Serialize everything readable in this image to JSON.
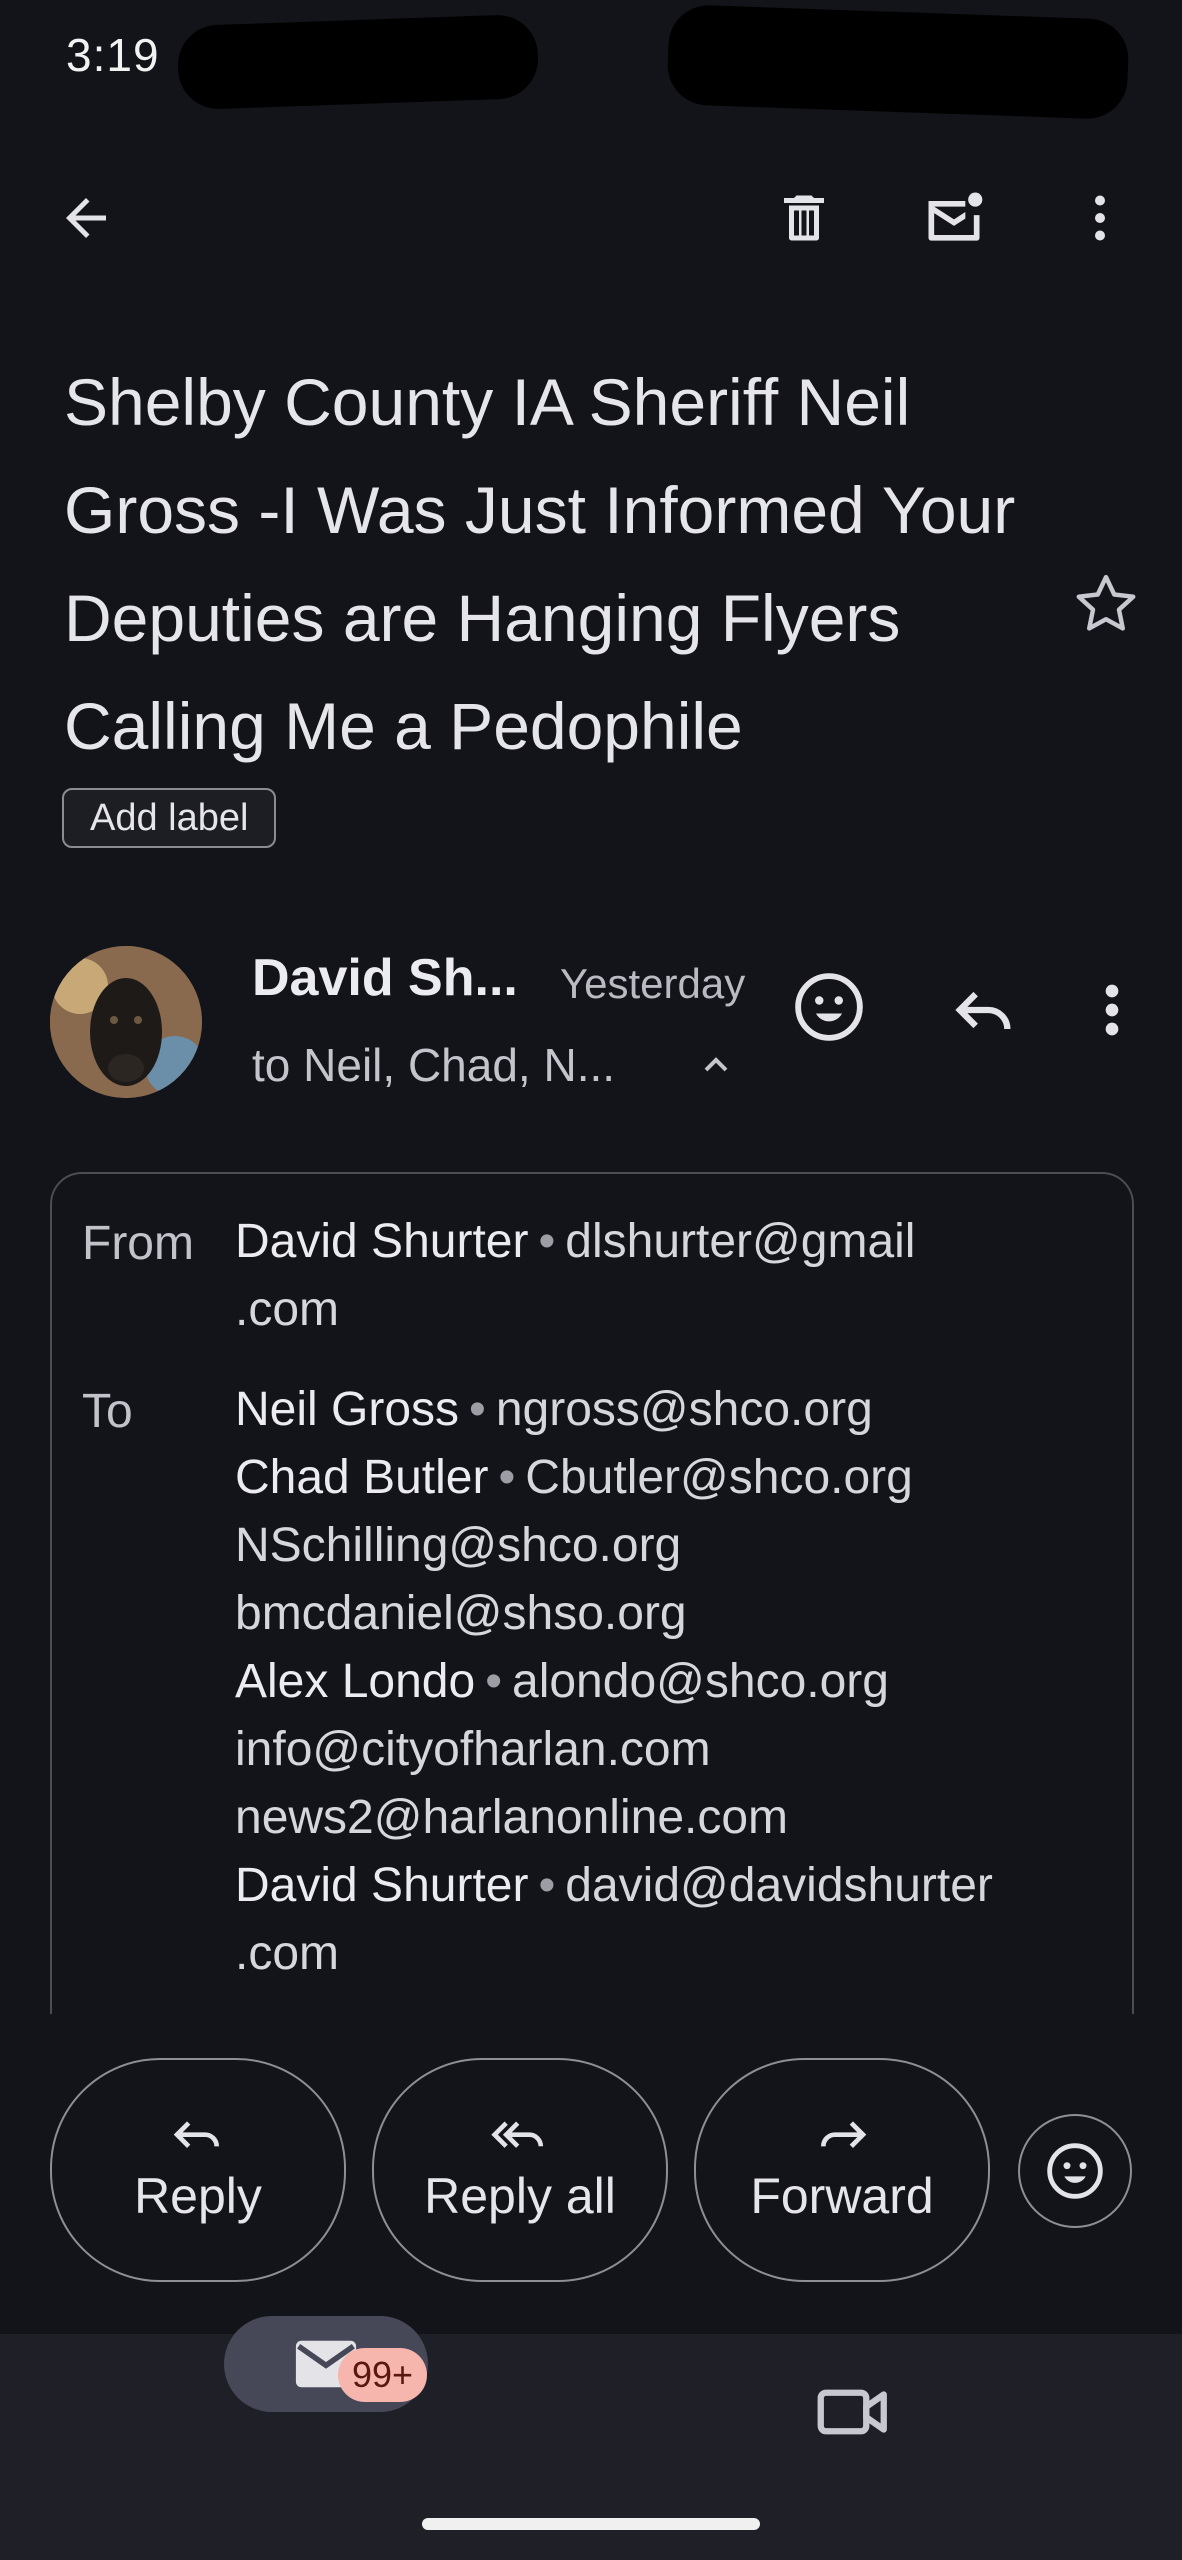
{
  "status_bar": {
    "time": "3:19"
  },
  "toolbar": {
    "back_icon": "arrow-back-icon",
    "delete_icon": "trash-icon",
    "mark_unread_icon": "mail-unread-icon",
    "more_icon": "more-vert-icon"
  },
  "email": {
    "subject": "Shelby County IA Sheriff Neil Gross -I Was Just Informed Your Deputies are Hanging Flyers Calling Me a Pedophile",
    "add_label": "Add label",
    "sender_short": "David Sh...",
    "date": "Yesterday",
    "recipients_short": "to Neil, Chad, N...",
    "details": {
      "from_label": "From",
      "from_name": "David Shurter",
      "from_email_line1": "dlshurter@gmail",
      "from_email_line2": ".com",
      "to_label": "To",
      "to": [
        {
          "name": "Neil Gross",
          "email": "ngross@shco.org"
        },
        {
          "name": "Chad Butler",
          "email": "Cbutler@shco.org"
        },
        {
          "name": "",
          "email": "NSchilling@shco.org"
        },
        {
          "name": "",
          "email": "bmcdaniel@shso.org"
        },
        {
          "name": "Alex Londo",
          "email": "alondo@shco.org"
        },
        {
          "name": "",
          "email": "info@cityofharlan.com"
        },
        {
          "name": "",
          "email": "news2@harlanonline.com"
        },
        {
          "name": "David Shurter",
          "email": "david@davidshurter"
        },
        {
          "name": "",
          "email": ".com"
        }
      ]
    }
  },
  "actions": {
    "reply": "Reply",
    "reply_all": "Reply all",
    "forward": "Forward"
  },
  "bottom_nav": {
    "mail_badge": "99+"
  },
  "colors": {
    "background": "#131419",
    "nav_bg": "#1f2027",
    "badge_bg": "#f6b5ad"
  }
}
